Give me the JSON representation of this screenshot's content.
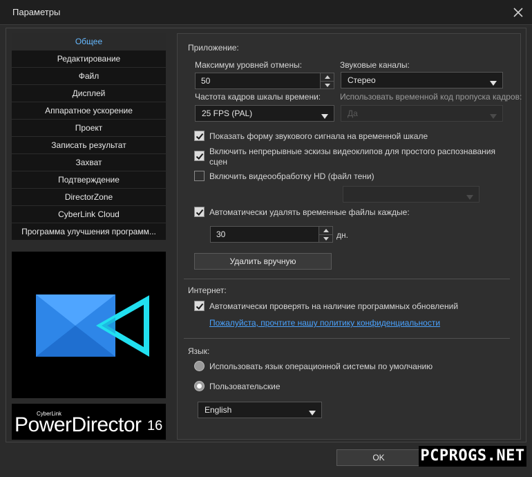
{
  "window": {
    "title": "Параметры"
  },
  "sidebar": {
    "items": [
      {
        "label": "Общее"
      },
      {
        "label": "Редактирование"
      },
      {
        "label": "Файл"
      },
      {
        "label": "Дисплей"
      },
      {
        "label": "Аппаратное ускорение"
      },
      {
        "label": "Проект"
      },
      {
        "label": "Записать результат"
      },
      {
        "label": "Захват"
      },
      {
        "label": "Подтверждение"
      },
      {
        "label": "DirectorZone"
      },
      {
        "label": "CyberLink Cloud"
      },
      {
        "label": "Программа улучшения программ..."
      }
    ]
  },
  "branding": {
    "company": "CyberLink",
    "product": "PowerDirector",
    "version": "16",
    "logo_color": "#29b6f6"
  },
  "application": {
    "section_title": "Приложение:",
    "undo": {
      "label": "Максимум уровней отмены:",
      "value": "50"
    },
    "audio_channels": {
      "label": "Звуковые каналы:",
      "value": "Стерео"
    },
    "frame_rate": {
      "label": "Частота кадров шкалы времени:",
      "value": "25 FPS (PAL)"
    },
    "drop_frame": {
      "label": "Использовать временной код пропуска кадров:",
      "value": "Да"
    },
    "opt_waveform": "Показать форму звукового сигнала на временной шкале",
    "opt_thumbnails_line1": "Включить непрерывные эскизы видеоклипов для простого распознавания",
    "opt_thumbnails_line2": "сцен",
    "opt_hd": "Включить видеообработку HD (файл тени)",
    "opt_autodelete": "Автоматически удалять временные файлы каждые:",
    "days_value": "30",
    "days_unit": "дн.",
    "delete_button": "Удалить вручную"
  },
  "internet": {
    "section_title": "Интернет:",
    "auto_update": "Автоматически проверять на наличие программных обновлений",
    "privacy_link": "Пожалуйста, прочтите нашу политику конфиденциальности"
  },
  "language": {
    "section_title": "Язык:",
    "opt_system": "Использовать язык операционной системы по умолчанию",
    "opt_custom": "Пользовательские",
    "selected": "English"
  },
  "footer": {
    "ok_button": "OK",
    "watermark": "PCPROGS.NET"
  },
  "colors": {
    "accent": "#66b9ff",
    "link": "#4aa3ff",
    "background": "#2b2b2b"
  }
}
